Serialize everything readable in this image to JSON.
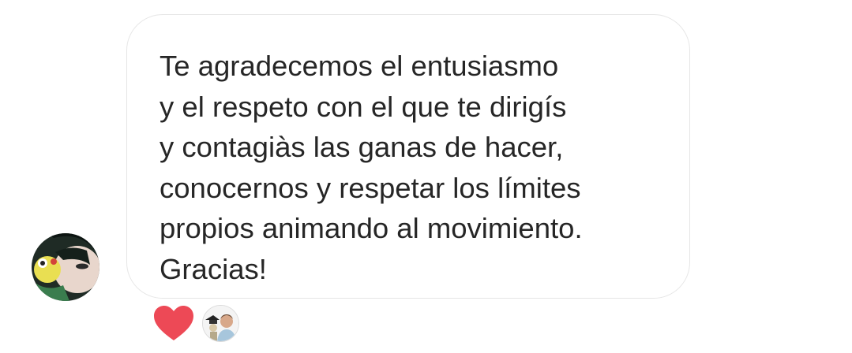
{
  "conversation": {
    "message": {
      "lines": [
        "Te agradecemos el entusiasmo",
        "y el respeto con el que te dirigís",
        "y contagiàs las ganas de hacer,",
        "conocernos y respetar los límites",
        "propios animando al movimiento.",
        "Gracias!"
      ]
    },
    "sender_avatar": {
      "icon": "profile-photo"
    },
    "reactions": [
      {
        "emoji": "heart-icon",
        "color": "#ed4956"
      },
      {
        "reactor": "reactor-profile-photo"
      }
    ]
  },
  "colors": {
    "bubble_border": "#e6e6e6",
    "text": "#262626",
    "heart": "#ed4956"
  }
}
